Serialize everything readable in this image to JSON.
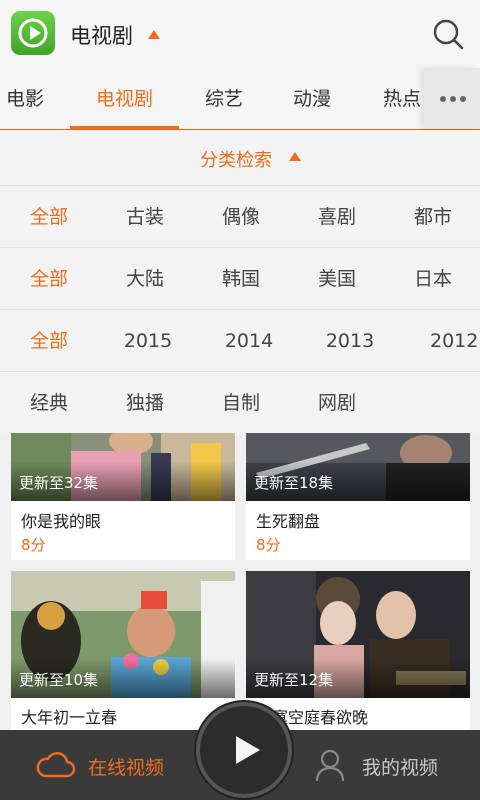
{
  "header": {
    "title": "电视剧",
    "logo_icon": "play-logo-icon",
    "search_icon": "search-icon"
  },
  "tabs": [
    {
      "label": "电影"
    },
    {
      "label": "电视剧"
    },
    {
      "label": "综艺"
    },
    {
      "label": "动漫"
    },
    {
      "label": "热点"
    }
  ],
  "filter": {
    "title": "分类检索",
    "rows": [
      [
        "全部",
        "古装",
        "偶像",
        "喜剧",
        "都市"
      ],
      [
        "全部",
        "大陆",
        "韩国",
        "美国",
        "日本"
      ],
      [
        "全部",
        "2015",
        "2014",
        "2013",
        "2012"
      ],
      [
        "经典",
        "独播",
        "自制",
        "网剧"
      ]
    ]
  },
  "cards": [
    {
      "episodes": "更新至32集",
      "title": "你是我的眼",
      "score": "8分"
    },
    {
      "episodes": "更新至18集",
      "title": "生死翻盘",
      "score": "8分"
    },
    {
      "episodes": "更新至10集",
      "title": "大年初一立春",
      "score": ""
    },
    {
      "episodes": "更新至12集",
      "title": "寂寞空庭春欲晚",
      "score": ""
    }
  ],
  "bottom_nav": {
    "online_label": "在线视频",
    "mine_label": "我的视频"
  },
  "colors": {
    "accent": "#f06d1c",
    "logo_green": "#4cb935",
    "bottom_bar": "#3a3a3a"
  }
}
